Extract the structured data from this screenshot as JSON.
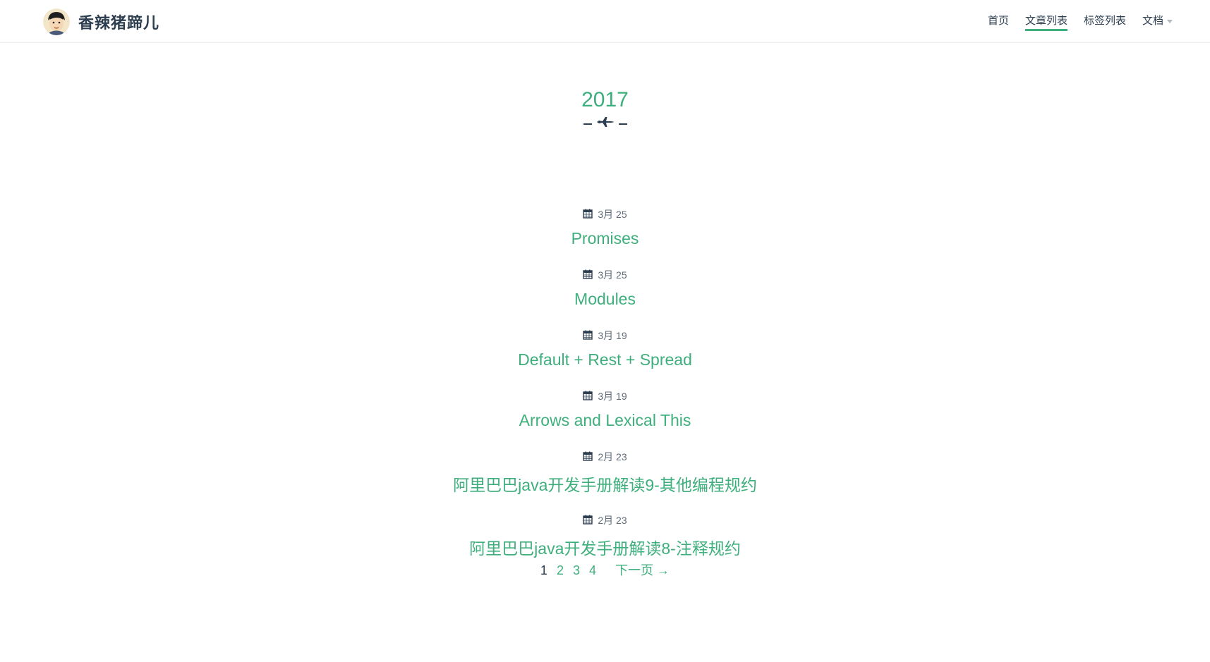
{
  "header": {
    "site_title": "香辣猪蹄儿",
    "nav": [
      {
        "label": "首页"
      },
      {
        "label": "文章列表",
        "active": true
      },
      {
        "label": "标签列表"
      },
      {
        "label": "文档",
        "has_dropdown": true
      }
    ]
  },
  "archive": {
    "year": "2017",
    "divider_icon": "airplane-icon",
    "posts": [
      {
        "date": "3月 25",
        "title": "Promises"
      },
      {
        "date": "3月 25",
        "title": "Modules"
      },
      {
        "date": "3月 19",
        "title": "Default + Rest + Spread"
      },
      {
        "date": "3月 19",
        "title": "Arrows and Lexical This"
      },
      {
        "date": "2月 23",
        "title": "阿里巴巴java开发手册解读9-其他编程规约"
      },
      {
        "date": "2月 23",
        "title": "阿里巴巴java开发手册解读8-注释规约"
      }
    ]
  },
  "pagination": {
    "pages": [
      "1",
      "2",
      "3",
      "4"
    ],
    "current": "1",
    "next_label": "下一页 →"
  },
  "colors": {
    "accent": "#3eaf7c",
    "text": "#2c3e50",
    "muted": "#5f6b78"
  }
}
